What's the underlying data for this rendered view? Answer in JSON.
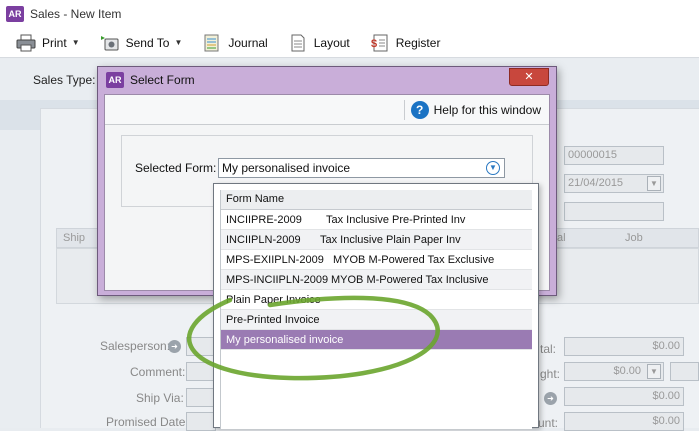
{
  "window": {
    "badge": "AR",
    "title": "Sales - New Item"
  },
  "toolbar": {
    "print": "Print",
    "send_to": "Send To",
    "journal": "Journal",
    "layout": "Layout",
    "register": "Register"
  },
  "background": {
    "sales_type_label": "Sales Type:",
    "invoice_no": "00000015",
    "date": "21/04/2015",
    "col_ship": "Ship",
    "col_al": "al",
    "col_job": "Job",
    "salesperson_label": "Salesperson:",
    "comment_label": "Comment:",
    "ship_via_label": "Ship Via:",
    "promised_date_label": "Promised Date:",
    "total_label": "tal:",
    "freight_label": "ght:",
    "paid_label": "unt:",
    "amount_1": "$0.00",
    "amount_2": "$0.00",
    "amount_3": "$0.00",
    "amount_4": "$0.00"
  },
  "dialog": {
    "badge": "AR",
    "title": "Select Form",
    "close": "✕",
    "help": "Help for this window",
    "selected_form_label": "Selected Form:",
    "selected_form_value": "My personalised invoice"
  },
  "dropdown": {
    "header": "Form Name",
    "rows": [
      {
        "name": "INCIIPRE-2009",
        "desc": "Tax Inclusive Pre-Printed Inv"
      },
      {
        "name": "INCIIPLN-2009",
        "desc": "Tax Inclusive Plain Paper Inv"
      },
      {
        "name": "MPS-EXIIPLN-2009",
        "desc": "MYOB M-Powered Tax Exclusive"
      },
      {
        "name": "MPS-INCIIPLN-2009",
        "desc": "MYOB M-Powered Tax Inclusive"
      },
      {
        "name": "Plain Paper Invoice",
        "desc": ""
      },
      {
        "name": "Pre-Printed Invoice",
        "desc": ""
      },
      {
        "name": "My personalised invoice",
        "desc": ""
      }
    ]
  },
  "colors": {
    "accent": "#7b3fa0",
    "selection": "#9a7bb3",
    "annotation": "#6aa52e"
  }
}
